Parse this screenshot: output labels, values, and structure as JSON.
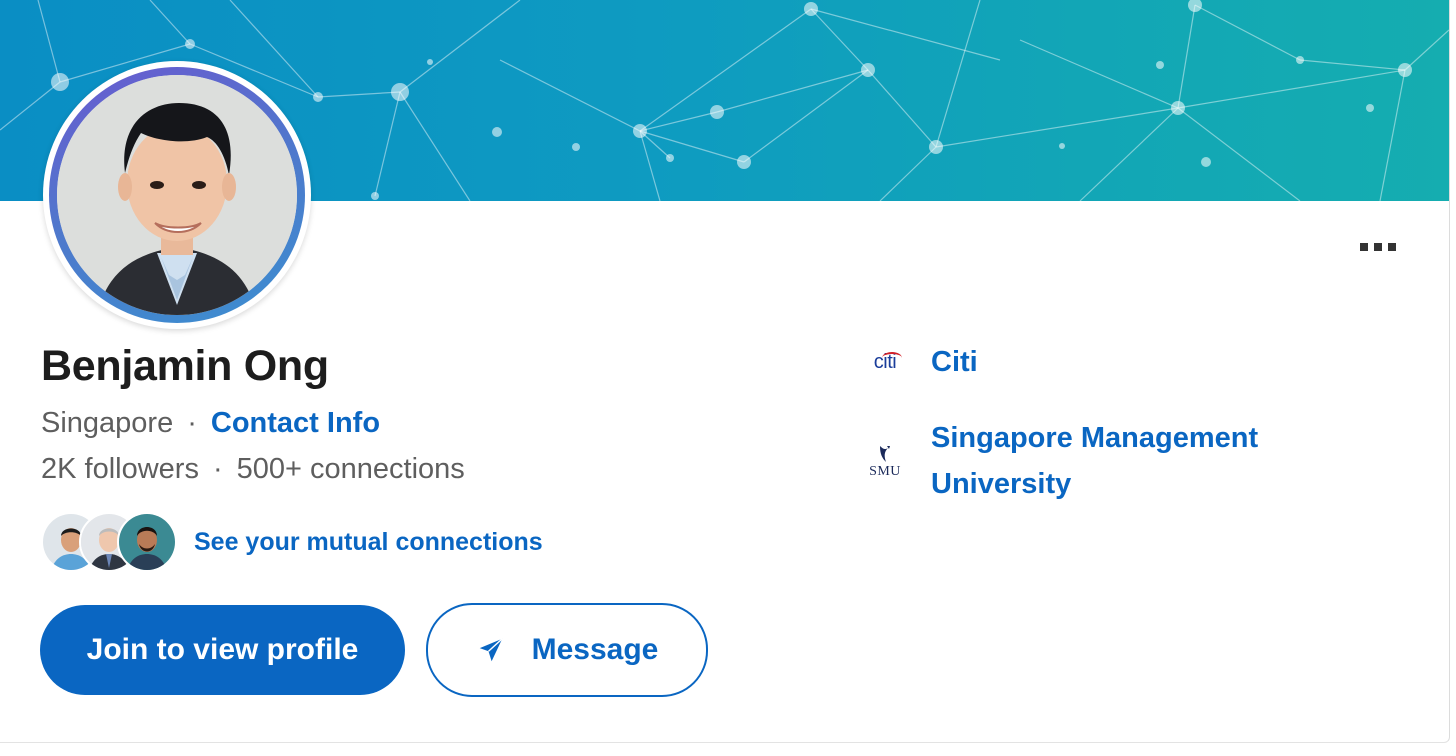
{
  "profile": {
    "name": "Benjamin Ong",
    "location": "Singapore",
    "contact_label": "Contact Info",
    "followers": "2K followers",
    "connections": "500+ connections",
    "mutual_label": "See your mutual connections",
    "separator": "·"
  },
  "actions": {
    "join_label": "Join to view profile",
    "message_label": "Message",
    "more_icon": "more-horizontal-icon"
  },
  "orgs": [
    {
      "name": "Citi",
      "logo_text": "citi",
      "logo": "citi-logo"
    },
    {
      "name": "Singapore Management University",
      "logo_text": "SMU",
      "logo": "smu-logo"
    }
  ],
  "colors": {
    "link": "#0a66c2",
    "primary_button": "#0a66c2",
    "banner_start": "#0a8ec4",
    "banner_end": "#15adb0"
  }
}
